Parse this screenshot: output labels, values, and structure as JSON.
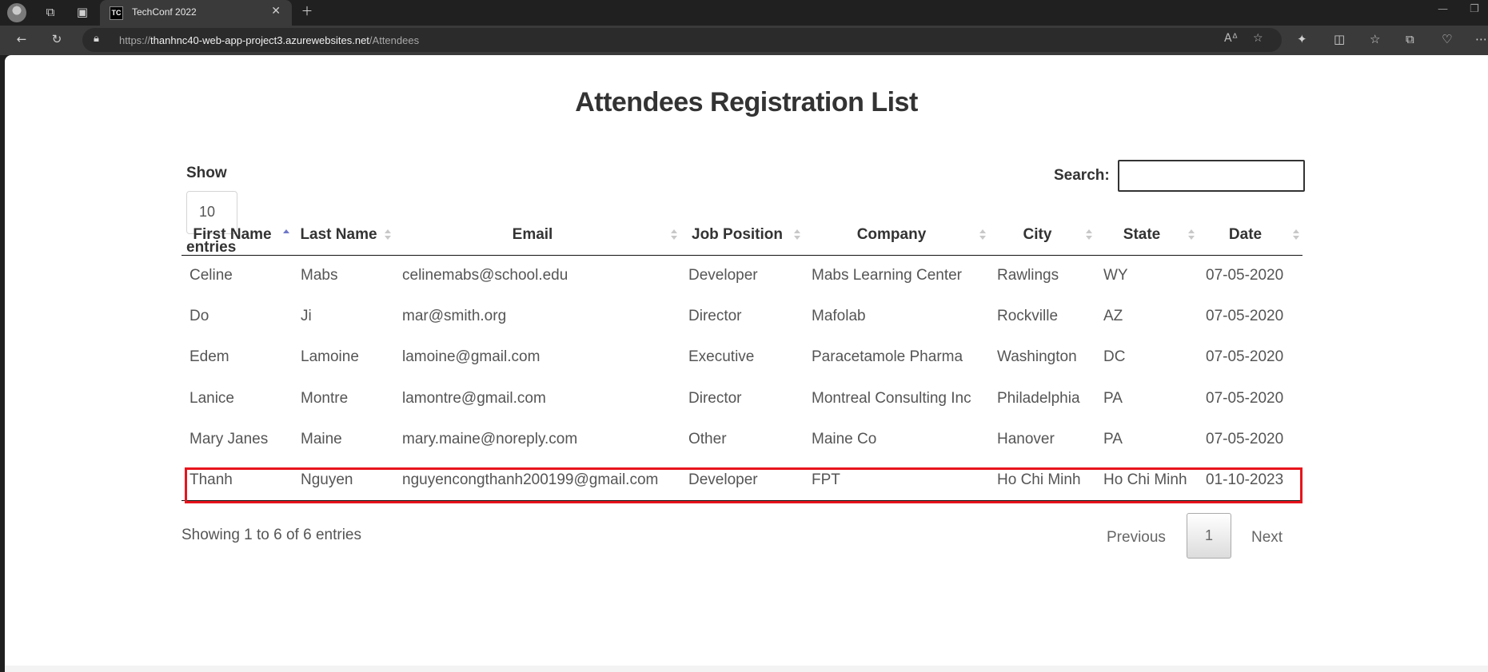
{
  "browser": {
    "tab_title": "TechConf 2022",
    "tab_favicon_text": "TC",
    "url_scheme": "https://",
    "url_domain": "thanhnc40-web-app-project3.azurewebsites.net",
    "url_path": "/Attendees",
    "icons": [
      "avatar",
      "workspaces-icon",
      "tab-actions-icon",
      "close-icon",
      "new-tab-icon",
      "back-icon",
      "refresh-icon",
      "lock-icon",
      "read-aloud-icon",
      "favorite-star-icon",
      "extensions-icon",
      "split-screen-icon",
      "favorites-icon",
      "collections-icon",
      "browser-essentials-icon",
      "more-icon"
    ]
  },
  "page": {
    "title": "Attendees Registration List",
    "length": {
      "label": "Show",
      "value": "10",
      "suffix": "entries"
    },
    "search": {
      "label": "Search:",
      "value": ""
    },
    "table": {
      "columns": [
        "First Name",
        "Last Name",
        "Email",
        "Job Position",
        "Company",
        "City",
        "State",
        "Date"
      ],
      "sorted_column": "First Name",
      "sort_direction": "ascending",
      "rows": [
        [
          "Celine",
          "Mabs",
          "celinemabs@school.edu",
          "Developer",
          "Mabs Learning Center",
          "Rawlings",
          "WY",
          "07-05-2020"
        ],
        [
          "Do",
          "Ji",
          "mar@smith.org",
          "Director",
          "Mafolab",
          "Rockville",
          "AZ",
          "07-05-2020"
        ],
        [
          "Edem",
          "Lamoine",
          "lamoine@gmail.com",
          "Executive",
          "Paracetamole Pharma",
          "Washington",
          "DC",
          "07-05-2020"
        ],
        [
          "Lanice",
          "Montre",
          "lamontre@gmail.com",
          "Director",
          "Montreal Consulting Inc",
          "Philadelphia",
          "PA",
          "07-05-2020"
        ],
        [
          "Mary Janes",
          "Maine",
          "mary.maine@noreply.com",
          "Other",
          "Maine Co",
          "Hanover",
          "PA",
          "07-05-2020"
        ],
        [
          "Thanh",
          "Nguyen",
          "nguyencongthanh200199@gmail.com",
          "Developer",
          "FPT",
          "Ho Chi Minh",
          "Ho Chi Minh",
          "01-10-2023"
        ]
      ],
      "highlighted_row": 5,
      "highlight_color": "#e8141c"
    },
    "info": "Showing 1 to 6 of 6 entries",
    "pagination": {
      "previous": "Previous",
      "current_page": "1",
      "next": "Next"
    }
  }
}
